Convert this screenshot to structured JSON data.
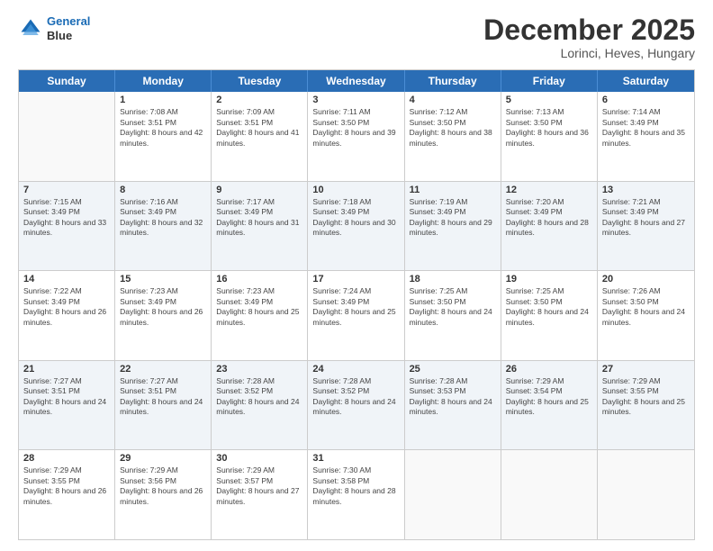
{
  "header": {
    "logo_line1": "General",
    "logo_line2": "Blue",
    "main_title": "December 2025",
    "subtitle": "Lorinci, Heves, Hungary"
  },
  "days_of_week": [
    "Sunday",
    "Monday",
    "Tuesday",
    "Wednesday",
    "Thursday",
    "Friday",
    "Saturday"
  ],
  "weeks": [
    [
      {
        "day": "",
        "sunrise": "",
        "sunset": "",
        "daylight": ""
      },
      {
        "day": "1",
        "sunrise": "7:08 AM",
        "sunset": "3:51 PM",
        "daylight": "8 hours and 42 minutes."
      },
      {
        "day": "2",
        "sunrise": "7:09 AM",
        "sunset": "3:51 PM",
        "daylight": "8 hours and 41 minutes."
      },
      {
        "day": "3",
        "sunrise": "7:11 AM",
        "sunset": "3:50 PM",
        "daylight": "8 hours and 39 minutes."
      },
      {
        "day": "4",
        "sunrise": "7:12 AM",
        "sunset": "3:50 PM",
        "daylight": "8 hours and 38 minutes."
      },
      {
        "day": "5",
        "sunrise": "7:13 AM",
        "sunset": "3:50 PM",
        "daylight": "8 hours and 36 minutes."
      },
      {
        "day": "6",
        "sunrise": "7:14 AM",
        "sunset": "3:49 PM",
        "daylight": "8 hours and 35 minutes."
      }
    ],
    [
      {
        "day": "7",
        "sunrise": "7:15 AM",
        "sunset": "3:49 PM",
        "daylight": "8 hours and 33 minutes."
      },
      {
        "day": "8",
        "sunrise": "7:16 AM",
        "sunset": "3:49 PM",
        "daylight": "8 hours and 32 minutes."
      },
      {
        "day": "9",
        "sunrise": "7:17 AM",
        "sunset": "3:49 PM",
        "daylight": "8 hours and 31 minutes."
      },
      {
        "day": "10",
        "sunrise": "7:18 AM",
        "sunset": "3:49 PM",
        "daylight": "8 hours and 30 minutes."
      },
      {
        "day": "11",
        "sunrise": "7:19 AM",
        "sunset": "3:49 PM",
        "daylight": "8 hours and 29 minutes."
      },
      {
        "day": "12",
        "sunrise": "7:20 AM",
        "sunset": "3:49 PM",
        "daylight": "8 hours and 28 minutes."
      },
      {
        "day": "13",
        "sunrise": "7:21 AM",
        "sunset": "3:49 PM",
        "daylight": "8 hours and 27 minutes."
      }
    ],
    [
      {
        "day": "14",
        "sunrise": "7:22 AM",
        "sunset": "3:49 PM",
        "daylight": "8 hours and 26 minutes."
      },
      {
        "day": "15",
        "sunrise": "7:23 AM",
        "sunset": "3:49 PM",
        "daylight": "8 hours and 26 minutes."
      },
      {
        "day": "16",
        "sunrise": "7:23 AM",
        "sunset": "3:49 PM",
        "daylight": "8 hours and 25 minutes."
      },
      {
        "day": "17",
        "sunrise": "7:24 AM",
        "sunset": "3:49 PM",
        "daylight": "8 hours and 25 minutes."
      },
      {
        "day": "18",
        "sunrise": "7:25 AM",
        "sunset": "3:50 PM",
        "daylight": "8 hours and 24 minutes."
      },
      {
        "day": "19",
        "sunrise": "7:25 AM",
        "sunset": "3:50 PM",
        "daylight": "8 hours and 24 minutes."
      },
      {
        "day": "20",
        "sunrise": "7:26 AM",
        "sunset": "3:50 PM",
        "daylight": "8 hours and 24 minutes."
      }
    ],
    [
      {
        "day": "21",
        "sunrise": "7:27 AM",
        "sunset": "3:51 PM",
        "daylight": "8 hours and 24 minutes."
      },
      {
        "day": "22",
        "sunrise": "7:27 AM",
        "sunset": "3:51 PM",
        "daylight": "8 hours and 24 minutes."
      },
      {
        "day": "23",
        "sunrise": "7:28 AM",
        "sunset": "3:52 PM",
        "daylight": "8 hours and 24 minutes."
      },
      {
        "day": "24",
        "sunrise": "7:28 AM",
        "sunset": "3:52 PM",
        "daylight": "8 hours and 24 minutes."
      },
      {
        "day": "25",
        "sunrise": "7:28 AM",
        "sunset": "3:53 PM",
        "daylight": "8 hours and 24 minutes."
      },
      {
        "day": "26",
        "sunrise": "7:29 AM",
        "sunset": "3:54 PM",
        "daylight": "8 hours and 25 minutes."
      },
      {
        "day": "27",
        "sunrise": "7:29 AM",
        "sunset": "3:55 PM",
        "daylight": "8 hours and 25 minutes."
      }
    ],
    [
      {
        "day": "28",
        "sunrise": "7:29 AM",
        "sunset": "3:55 PM",
        "daylight": "8 hours and 26 minutes."
      },
      {
        "day": "29",
        "sunrise": "7:29 AM",
        "sunset": "3:56 PM",
        "daylight": "8 hours and 26 minutes."
      },
      {
        "day": "30",
        "sunrise": "7:29 AM",
        "sunset": "3:57 PM",
        "daylight": "8 hours and 27 minutes."
      },
      {
        "day": "31",
        "sunrise": "7:30 AM",
        "sunset": "3:58 PM",
        "daylight": "8 hours and 28 minutes."
      },
      {
        "day": "",
        "sunrise": "",
        "sunset": "",
        "daylight": ""
      },
      {
        "day": "",
        "sunrise": "",
        "sunset": "",
        "daylight": ""
      },
      {
        "day": "",
        "sunrise": "",
        "sunset": "",
        "daylight": ""
      }
    ]
  ]
}
